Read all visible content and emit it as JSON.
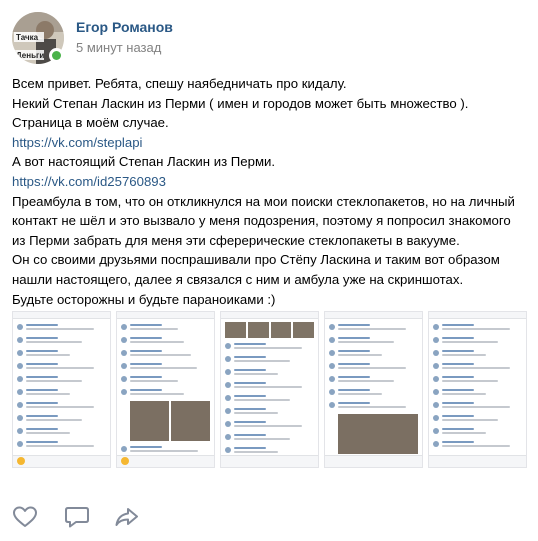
{
  "post": {
    "author": "Егор Романов",
    "time": "5 минут назад",
    "avatar": {
      "text_top": "Тачка",
      "text_bottom": "Деньги"
    },
    "text_lines": [
      {
        "text": "Всем привет. Ребята, спешу наябедничать про кидалу.",
        "link": false
      },
      {
        "text": "Некий Степан Ласкин из Перми ( имен и городов может быть множество ).",
        "link": false
      },
      {
        "text": "Страница в моём случае.",
        "link": false
      },
      {
        "text": "https://vk.com/steplapi",
        "link": true
      },
      {
        "text": "А вот настоящий Степан Ласкин из Перми.",
        "link": false
      },
      {
        "text": "https://vk.com/id25760893",
        "link": true
      },
      {
        "text": "Преамбула в том, что он откликнулся на мои поиски стеклопакетов, но на личный",
        "link": false
      },
      {
        "text": "контакт не шёл и это вызвало у меня подозрения, поэтому я попросил знакомого",
        "link": false
      },
      {
        "text": "из Перми забрать для меня эти сферерические стеклопакеты в вакууме.",
        "link": false
      },
      {
        "text": "Он со своими друзьями поспрашивали про Стёпу Ласкина и таким вот образом",
        "link": false
      },
      {
        "text": "нашли настоящего, далее я связался с ним и амбула уже на скриншотах.",
        "link": false
      },
      {
        "text": "Будьте осторожны и будьте параноиками :)",
        "link": false
      }
    ]
  },
  "gallery": {
    "count": 5,
    "items": [
      {
        "kind": "chat-screenshot"
      },
      {
        "kind": "chat-screenshot-with-photos"
      },
      {
        "kind": "chat-screenshot-photo-header"
      },
      {
        "kind": "chat-screenshot-with-photo"
      },
      {
        "kind": "chat-screenshot"
      }
    ]
  },
  "actions": {
    "like_icon": "heart-icon",
    "comment_icon": "comment-icon",
    "share_icon": "share-icon"
  },
  "colors": {
    "link": "#2a5885",
    "secondary_text": "#828282",
    "online": "#4bb34b",
    "icon": "#828a99"
  }
}
